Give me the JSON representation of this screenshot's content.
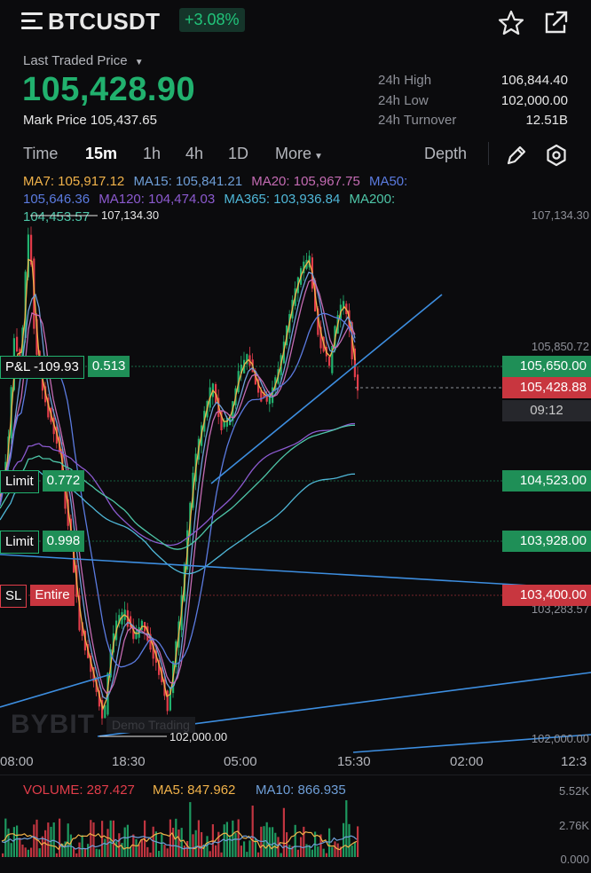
{
  "header": {
    "symbol": "BTCUSDT",
    "change": "+3.08%",
    "icons": [
      "menu-icon",
      "star-icon",
      "share-icon"
    ]
  },
  "price": {
    "last_label": "Last Traded Price",
    "last": "105,428.90",
    "mark_label": "Mark Price",
    "mark": "105,437.65"
  },
  "stats": {
    "high_label": "24h High",
    "high": "106,844.40",
    "low_label": "24h Low",
    "low": "102,000.00",
    "turnover_label": "24h Turnover",
    "turnover": "12.51B"
  },
  "tabs": {
    "time": "Time",
    "t15m": "15m",
    "t1h": "1h",
    "t4h": "4h",
    "t1d": "1D",
    "more": "More",
    "depth": "Depth",
    "active": "15m"
  },
  "ma": {
    "ma7": "MA7: 105,917.12",
    "ma15": "MA15: 105,841.21",
    "ma20": "MA20: 105,967.75",
    "ma50": "MA50: 105,646.36",
    "ma120": "MA120: 104,474.03",
    "ma365": "MA365: 103,936.84",
    "ma200": "MA200: 104,453.57"
  },
  "chart": {
    "max_label": "107,134.30",
    "min_label": "102,000.00",
    "axis": [
      "107,134.30",
      "105,850.72",
      "103,283.57",
      "102,000.00"
    ],
    "pnl_label": "P&L -109.93",
    "pnl_qty": "0.513",
    "pnl_price": "105,650.00",
    "last_price": "105,428.88",
    "countdown": "09:12",
    "limit1_label": "Limit",
    "limit1_qty": "0.772",
    "limit1_price": "104,523.00",
    "limit2_label": "Limit",
    "limit2_qty": "0.998",
    "limit2_price": "103,928.00",
    "sl_label": "SL",
    "sl_qty": "Entire",
    "sl_price": "103,400.00",
    "watermark": "BYBIT",
    "watermark_sub": "Demo Trading",
    "times": [
      "08:00",
      "18:30",
      "05:00",
      "15:30",
      "02:00",
      "12:3"
    ]
  },
  "volume": {
    "vol": "VOLUME: 287.427",
    "ma5": "MA5: 847.962",
    "ma10": "MA10: 866.935",
    "axis": [
      "5.52K",
      "2.76K",
      "0.000"
    ]
  },
  "colors": {
    "up": "#21b16e",
    "down": "#e23d4a",
    "ma7": "#f2b34a",
    "ma15": "#6f9fd8",
    "ma20": "#c46bb3",
    "ma50": "#5b7be0",
    "ma120": "#8c5ad0",
    "ma365": "#4fb7d8",
    "ma200": "#4ec6a8",
    "trend": "#3d8ee0"
  }
}
